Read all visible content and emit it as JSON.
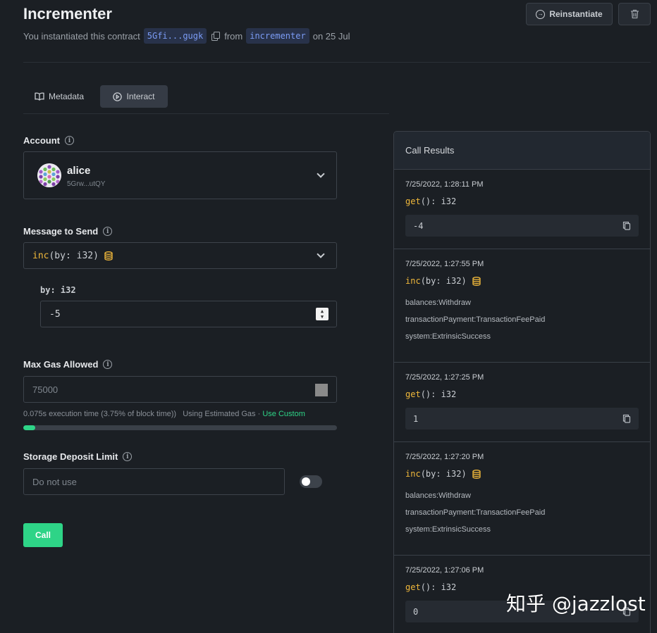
{
  "header": {
    "title": "Incrementer",
    "instantiated_prefix": "You instantiated this contract",
    "address": "5Gfi...gugk",
    "from_word": "from",
    "code_name": "incrementer",
    "date_text": "on 25 Jul",
    "reinstantiate_label": "Reinstantiate"
  },
  "tabs": [
    {
      "label": "Metadata",
      "icon": "book-icon"
    },
    {
      "label": "Interact",
      "icon": "play-circle-icon",
      "active": true
    }
  ],
  "account": {
    "label": "Account",
    "name": "alice",
    "address": "5Grw...utQY"
  },
  "message": {
    "label": "Message to Send",
    "fn": "inc",
    "args": "(by: i32)",
    "arg_label": "by: i32",
    "arg_value": "-5"
  },
  "gas": {
    "label": "Max Gas Allowed",
    "placeholder": "75000",
    "info": "0.075s execution time (3.75% of block time))",
    "mode": "Using Estimated Gas",
    "custom_link": "Use Custom",
    "fill_fraction": 0.0375
  },
  "storage": {
    "label": "Storage Deposit Limit",
    "placeholder": "Do not use",
    "toggle_on": false
  },
  "call_label": "Call",
  "results": {
    "title": "Call Results",
    "items": [
      {
        "time": "7/25/2022, 1:28:11 PM",
        "fn": "get",
        "sig": "(): i32",
        "output": "-4"
      },
      {
        "time": "7/25/2022, 1:27:55 PM",
        "fn": "inc",
        "sig": "(by: i32)",
        "events": [
          "balances:Withdraw",
          "transactionPayment:TransactionFeePaid",
          "system:ExtrinsicSuccess"
        ]
      },
      {
        "time": "7/25/2022, 1:27:25 PM",
        "fn": "get",
        "sig": "(): i32",
        "output": "1"
      },
      {
        "time": "7/25/2022, 1:27:20 PM",
        "fn": "inc",
        "sig": "(by: i32)",
        "events": [
          "balances:Withdraw",
          "transactionPayment:TransactionFeePaid",
          "system:ExtrinsicSuccess"
        ]
      },
      {
        "time": "7/25/2022, 1:27:06 PM",
        "fn": "get",
        "sig": "(): i32",
        "output": "0"
      }
    ]
  },
  "watermark": "知乎 @jazzlost",
  "colors": {
    "accent_green": "#2ed487",
    "fn_orange": "#f0b83b",
    "chip_blue": "#7b9cf5"
  }
}
